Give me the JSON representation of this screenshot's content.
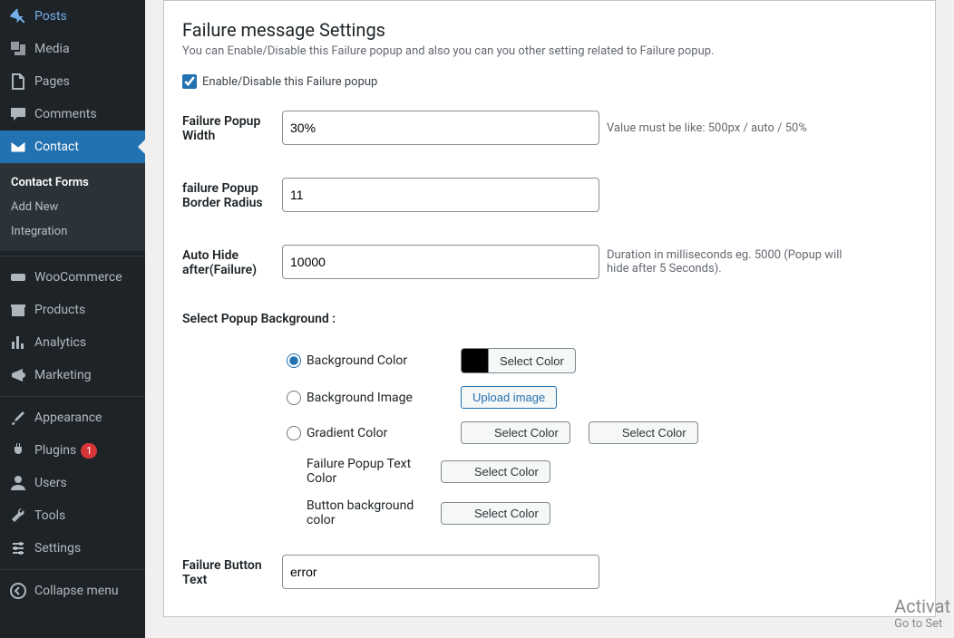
{
  "sidebar": {
    "items": [
      {
        "label": "Posts"
      },
      {
        "label": "Media"
      },
      {
        "label": "Pages"
      },
      {
        "label": "Comments"
      },
      {
        "label": "Contact"
      },
      {
        "label": "WooCommerce"
      },
      {
        "label": "Products"
      },
      {
        "label": "Analytics"
      },
      {
        "label": "Marketing"
      },
      {
        "label": "Appearance"
      },
      {
        "label": "Plugins",
        "badge": "1"
      },
      {
        "label": "Users"
      },
      {
        "label": "Tools"
      },
      {
        "label": "Settings"
      },
      {
        "label": "Collapse menu"
      }
    ],
    "submenu": [
      {
        "label": "Contact Forms"
      },
      {
        "label": "Add New"
      },
      {
        "label": "Integration"
      }
    ]
  },
  "page": {
    "title": "Failure message Settings",
    "description": "You can Enable/Disable this Failure popup and also you can you other setting related to Failure popup.",
    "enable_label": "Enable/Disable this Failure popup",
    "fields": {
      "width": {
        "label": "Failure Popup Width",
        "value": "30%",
        "hint": "Value must be like: 500px / auto / 50%"
      },
      "radius": {
        "label": "failure Popup Border Radius",
        "value": "11"
      },
      "autohide": {
        "label": "Auto Hide after(Failure)",
        "value": "10000",
        "hint": "Duration in milliseconds eg. 5000 (Popup will hide after 5 Seconds)."
      },
      "button_text": {
        "label": "Failure Button Text",
        "value": "error"
      }
    },
    "background": {
      "section_label": "Select Popup Background :",
      "options": {
        "bgcolor": "Background Color",
        "bgimage": "Background Image",
        "gradient": "Gradient Color",
        "textcolor": "Failure Popup Text Color",
        "btnbg": "Button background color"
      },
      "swatch_color": "#000000",
      "select_color_btn": "Select Color",
      "upload_btn": "Upload image"
    }
  },
  "watermark": {
    "title": "Activat",
    "sub": "Go to Set"
  }
}
